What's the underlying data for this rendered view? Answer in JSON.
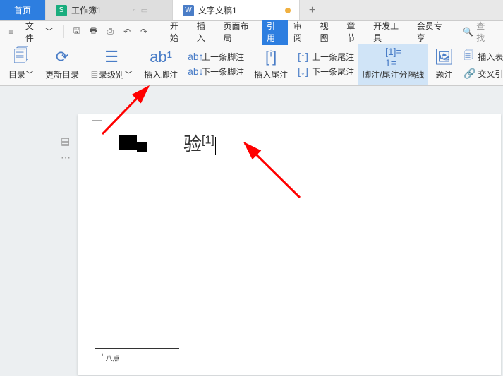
{
  "tabs": {
    "home": "首页",
    "sheet_label": "工作簿1",
    "doc_label": "文字文稿1",
    "new": "+"
  },
  "menubar": {
    "file": "文件",
    "search_placeholder": "查找",
    "items": [
      "开始",
      "插入",
      "页面布局",
      "引用",
      "审阅",
      "视图",
      "章节",
      "开发工具",
      "会员专享"
    ],
    "active_index": 3
  },
  "ribbon": {
    "toc": "目录",
    "update_toc": "更新目录",
    "toc_level": "目录级别",
    "insert_footnote": "插入脚注",
    "prev_footnote": "上一条脚注",
    "next_footnote": "下一条脚注",
    "insert_endnote": "插入尾注",
    "prev_endnote": "上一条尾注",
    "next_endnote": "下一条尾注",
    "separator": "脚注/尾注分隔线",
    "caption": "题注",
    "insert_tof": "插入表目录",
    "cross_ref": "交叉引用"
  },
  "document": {
    "body_char": "验",
    "footnote_ref": "[1]",
    "footnote_mark": "¹",
    "footnote_text": "八点"
  },
  "colors": {
    "accent": "#2d7ee0",
    "arrow": "#ff0000"
  }
}
